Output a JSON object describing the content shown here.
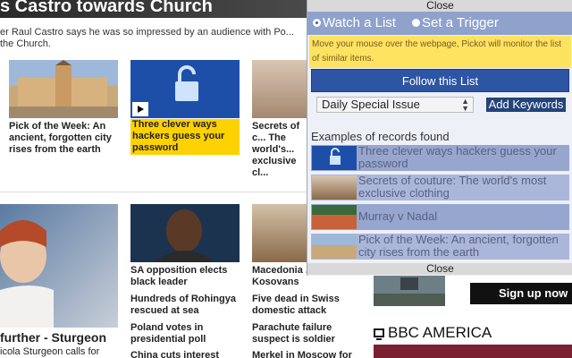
{
  "page": {
    "headline": "s Castro towards Church",
    "subline": "er Raul Castro says he was so impressed by an audience with Po... the Church.",
    "stories_top": [
      {
        "title": "Pick of the Week: An ancient, forgotten city rises from the earth"
      },
      {
        "title": "Three clever ways hackers guess your password"
      },
      {
        "title": "Secrets of c... The world's... exclusive cl..."
      }
    ],
    "feature": {
      "title": "further - Sturgeon",
      "text": "icola Sturgeon calls for"
    },
    "col2_stories": [
      "SA opposition elects black leader",
      "Hundreds of Rohingya rescued at sea",
      "Poland votes in presidential poll",
      "China cuts interest"
    ],
    "col3_stories": [
      "Macedonia ... clashes on Kosovans",
      "Five dead in Swiss domestic attack",
      "Parachute failure suspect is soldier",
      "Merkel in Moscow for"
    ],
    "signup_label": "Sign up now",
    "bbc_america": "BBC AMERICA"
  },
  "overlay": {
    "close_label": "Close",
    "mode_watch": "Watch a List",
    "mode_trigger": "Set a Trigger",
    "notice": "Move your mouse over the webpage, Pickot will monitor the list of similar items.",
    "follow_label": "Follow this List",
    "select_value": "Daily Special Issue",
    "keywords_label": "Add Keywords",
    "examples_label": "Examples of records found",
    "records": [
      {
        "text": "Three clever ways hackers guess your password"
      },
      {
        "text": "Secrets of couture: The world's most exclusive clothing"
      },
      {
        "text": "Murray v Nadal"
      },
      {
        "text": "Pick of the Week: An ancient, forgotten city rises from the earth"
      }
    ]
  },
  "colors": {
    "accent_blue": "#2e55a3",
    "mode_bar": "#8fa2cc",
    "notice_yellow": "#fde35f",
    "bbc_yellow": "#fed100"
  }
}
